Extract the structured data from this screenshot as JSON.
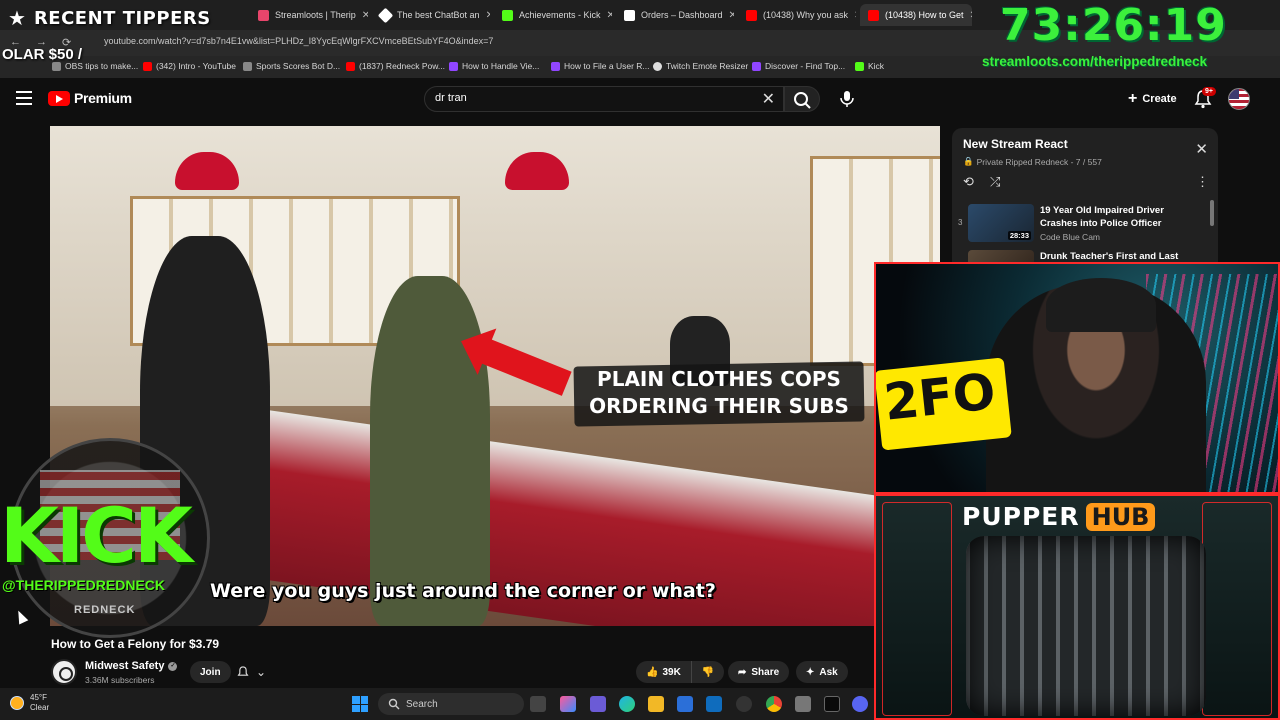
{
  "tabs": [
    {
      "label": "Streamloots | Therip",
      "color": "#e8456b"
    },
    {
      "label": "The best ChatBot an",
      "color": "#ffffff"
    },
    {
      "label": "Achievements - Kick",
      "color": "#53fc18"
    },
    {
      "label": "Orders – Dashboard",
      "color": "#ffffff"
    },
    {
      "label": "(10438) Why you ask",
      "color": "#ff0000"
    },
    {
      "label": "(10438) How to Get",
      "color": "#ff0000"
    }
  ],
  "url": "youtube.com/watch?v=d7sb7n4E1vw&list=PLHDz_I8YycEqWlgrFXCVmceBEtSubYF4O&index=7",
  "bookmarks": [
    {
      "label": "OBS tips to make...",
      "color": "#888888"
    },
    {
      "label": "(342) Intro - YouTube",
      "color": "#ff0000"
    },
    {
      "label": "Sports Scores Bot D...",
      "color": "#888888"
    },
    {
      "label": "(1837) Redneck Pow...",
      "color": "#ff0000"
    },
    {
      "label": "How to Handle Vie...",
      "color": "#9146ff"
    },
    {
      "label": "How to File a User R...",
      "color": "#9146ff"
    },
    {
      "label": "Twitch Emote Resizer",
      "color": "#dddddd"
    },
    {
      "label": "Discover - Find Top...",
      "color": "#9146ff"
    },
    {
      "label": "Kick",
      "color": "#53fc18"
    }
  ],
  "overlay": {
    "recent_tippers": "RECENT TIPPERS",
    "tipper": "OLAR $50 /",
    "timer": "73:26:19",
    "timer_url": "streamloots.com/therippedredneck",
    "kick": "KICK",
    "kick_handle": "@THERIPPEDREDNECK",
    "redneck": "REDNECK",
    "cam_sign": "2FO",
    "pupper_1": "PUPPER",
    "pupper_2": "HUB"
  },
  "header": {
    "logo": "Premium",
    "search_value": "dr tran",
    "create": "Create",
    "notif_badge": "9+"
  },
  "video": {
    "banner": "PLAIN CLOTHES COPS\nORDERING THEIR SUBS",
    "caption": "Were you guys just around the corner or what?",
    "title": "How to Get a Felony for $3.79",
    "channel": "Midwest Safety",
    "subscribers": "3.36M subscribers",
    "join": "Join",
    "likes": "39K",
    "share": "Share",
    "ask": "Ask"
  },
  "playlist": {
    "title": "New Stream React",
    "subtitle": "Private Ripped Redneck - 7 / 557",
    "items": [
      {
        "index": "3",
        "title": "19 Year Old Impaired Driver Crashes into Police Officer",
        "channel": "Code Blue Cam",
        "duration": "28:33"
      },
      {
        "index": "",
        "title": "Drunk Teacher's First and Last",
        "channel": "",
        "duration": ""
      }
    ]
  },
  "taskbar": {
    "temp": "45°F",
    "condition": "Clear",
    "search": "Search"
  },
  "colors": {
    "kick_green": "#53fc18",
    "timer_green": "#3cf03c",
    "yt_red": "#ff0000"
  }
}
